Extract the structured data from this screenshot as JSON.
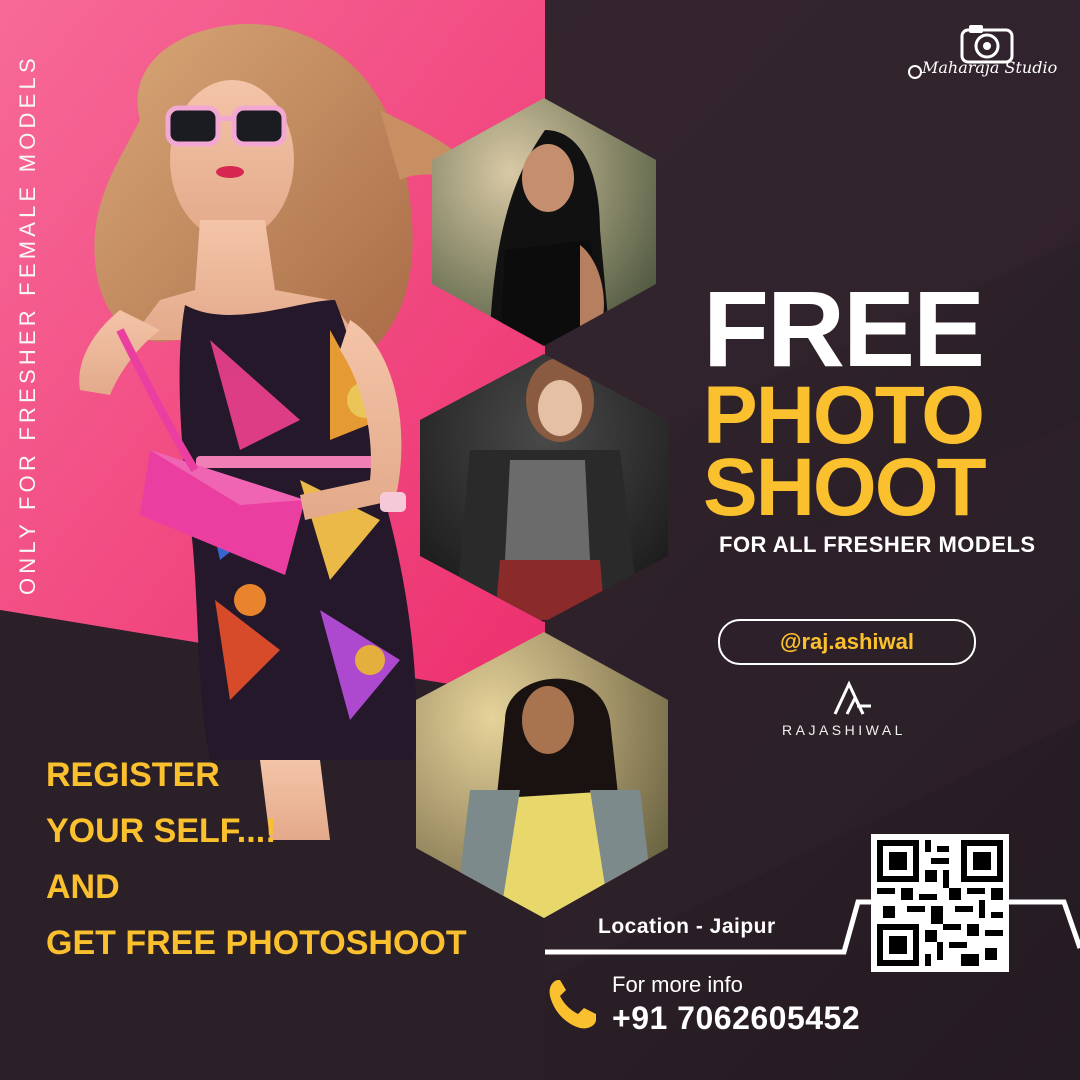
{
  "studio": {
    "name": "Maharaja Studio"
  },
  "side_text": "ONLY FOR FRESHER FEMALE MODELS",
  "headline": {
    "line1": "FREE",
    "line2": "PHOTO",
    "line3": "SHOOT"
  },
  "subheadline": "FOR ALL FRESHER MODELS",
  "handle": "@raj.ashiwal",
  "brand": {
    "name": "RAJASHIWAL"
  },
  "register": {
    "line1": "REGISTER",
    "line2": "YOUR SELF...!",
    "line3": "AND",
    "line4": "GET FREE PHOTOSHOOT"
  },
  "location": "Location - Jaipur",
  "contact": {
    "label": "For more info",
    "phone": "+91 7062605452"
  },
  "icons": {
    "phone": "phone-icon",
    "camera": "camera-icon",
    "film": "film-reel-icon",
    "qr": "qr-code"
  },
  "colors": {
    "pink": "#f0407a",
    "dark": "#2b1f28",
    "yellow": "#fbc02d",
    "white": "#ffffff"
  }
}
